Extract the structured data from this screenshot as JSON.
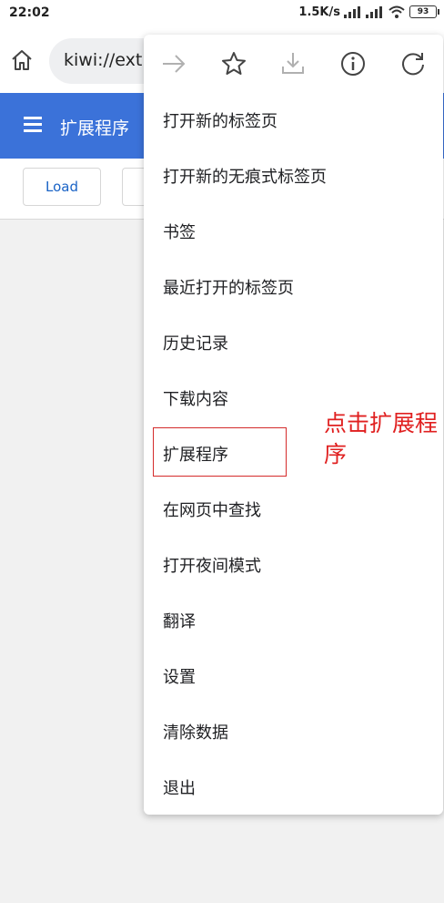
{
  "status": {
    "time": "22:02",
    "net_speed": "1.5K/s",
    "battery": "93"
  },
  "toolbar": {
    "url": "kiwi://ext"
  },
  "page": {
    "title": "扩展程序",
    "load_button": "Load"
  },
  "menu": {
    "items": [
      "打开新的标签页",
      "打开新的无痕式标签页",
      "书签",
      "最近打开的标签页",
      "历史记录",
      "下载内容",
      "扩展程序",
      "在网页中查找",
      "打开夜间模式",
      "翻译",
      "设置",
      "清除数据",
      "退出"
    ]
  },
  "annotation": {
    "text": "点击扩展程序",
    "color": "#e02020"
  },
  "colors": {
    "appbar": "#3b72d9",
    "link": "#1a63c6"
  }
}
